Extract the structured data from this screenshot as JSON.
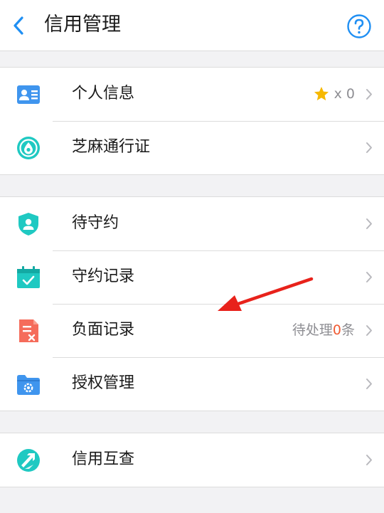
{
  "header": {
    "title": "信用管理",
    "back_icon": "chevron-left-icon",
    "help_icon": "question-circle-icon"
  },
  "groups": [
    {
      "items": [
        {
          "label": "个人信息",
          "icon": "id-card-icon",
          "badge": {
            "icon": "star-icon",
            "text": "x 0"
          }
        },
        {
          "label": "芝麻通行证",
          "icon": "sesame-pass-icon"
        }
      ]
    },
    {
      "items": [
        {
          "label": "待守约",
          "icon": "shield-user-icon"
        },
        {
          "label": "守约记录",
          "icon": "calendar-check-icon"
        },
        {
          "label": "负面记录",
          "icon": "negative-record-icon",
          "status": {
            "prefix": "待处理",
            "count": "0",
            "suffix": "条"
          }
        },
        {
          "label": "授权管理",
          "icon": "folder-gear-icon"
        }
      ]
    },
    {
      "items": [
        {
          "label": "信用互查",
          "icon": "mutual-check-icon"
        }
      ]
    }
  ],
  "colors": {
    "accent_blue": "#1f8ff3",
    "teal": "#1fc9c2",
    "red_icon": "#f56c5b",
    "star": "#f6b800",
    "count_orange": "#f05a32",
    "annotation_red": "#e8221b",
    "background": "#f2f2f4"
  }
}
